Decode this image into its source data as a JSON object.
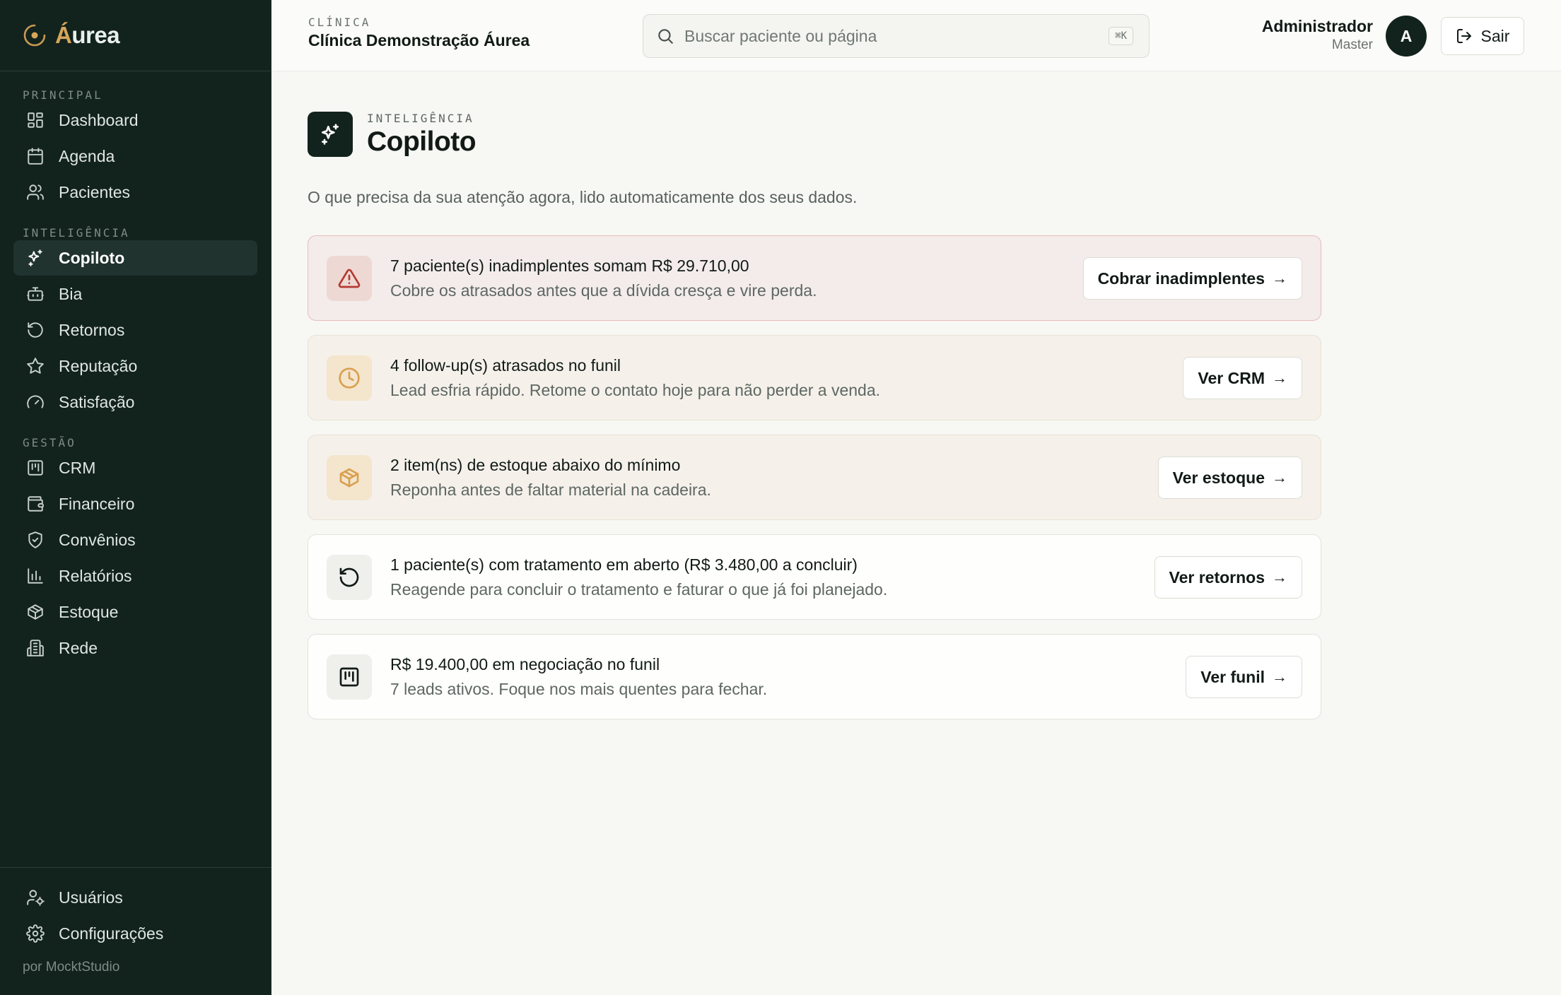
{
  "brand": {
    "name_first": "Á",
    "name_rest": "urea",
    "accent": "#d6a65a",
    "sidebar_bg": "#12221d"
  },
  "sidebar": {
    "sections": [
      {
        "label": "PRINCIPAL",
        "items": [
          {
            "label": "Dashboard",
            "icon": "dashboard-icon"
          },
          {
            "label": "Agenda",
            "icon": "calendar-icon"
          },
          {
            "label": "Pacientes",
            "icon": "users-icon"
          }
        ]
      },
      {
        "label": "INTELIGÊNCIA",
        "items": [
          {
            "label": "Copiloto",
            "icon": "sparkles-icon",
            "active": true
          },
          {
            "label": "Bia",
            "icon": "bot-icon"
          },
          {
            "label": "Retornos",
            "icon": "rotate-icon"
          },
          {
            "label": "Reputação",
            "icon": "star-icon"
          },
          {
            "label": "Satisfação",
            "icon": "gauge-icon"
          }
        ]
      },
      {
        "label": "GESTÃO",
        "items": [
          {
            "label": "CRM",
            "icon": "kanban-icon"
          },
          {
            "label": "Financeiro",
            "icon": "wallet-icon"
          },
          {
            "label": "Convênios",
            "icon": "shield-icon"
          },
          {
            "label": "Relatórios",
            "icon": "bar-chart-icon"
          },
          {
            "label": "Estoque",
            "icon": "package-icon"
          },
          {
            "label": "Rede",
            "icon": "building-icon"
          }
        ]
      }
    ],
    "bottom": [
      {
        "label": "Usuários",
        "icon": "user-cog-icon"
      },
      {
        "label": "Configurações",
        "icon": "settings-icon"
      }
    ],
    "powered_by": "por MocktStudio"
  },
  "topbar": {
    "clinic_label": "CLÍNICA",
    "clinic_name": "Clínica Demonstração Áurea",
    "search_placeholder": "Buscar paciente ou página",
    "search_shortcut": "⌘K",
    "user_name": "Administrador",
    "user_role": "Master",
    "avatar_initial": "A",
    "logout_label": "Sair"
  },
  "page": {
    "overline": "INTELIGÊNCIA",
    "title": "Copiloto",
    "description": "O que precisa da sua atenção agora, lido automaticamente dos seus dados."
  },
  "cards": [
    {
      "tone": "danger",
      "icon": "alert-triangle-icon",
      "title": "7 paciente(s) inadimplentes somam R$ 29.710,00",
      "subtitle": "Cobre os atrasados antes que a dívida cresça e vire perda.",
      "action": "Cobrar inadimplentes"
    },
    {
      "tone": "warn",
      "icon": "clock-icon",
      "title": "4 follow-up(s) atrasados no funil",
      "subtitle": "Lead esfria rápido. Retome o contato hoje para não perder a venda.",
      "action": "Ver CRM"
    },
    {
      "tone": "warn",
      "icon": "package-icon",
      "title": "2 item(ns) de estoque abaixo do mínimo",
      "subtitle": "Reponha antes de faltar material na cadeira.",
      "action": "Ver estoque"
    },
    {
      "tone": "neutral",
      "icon": "rotate-icon",
      "title": "1 paciente(s) com tratamento em aberto (R$ 3.480,00 a concluir)",
      "subtitle": "Reagende para concluir o tratamento e faturar o que já foi planejado.",
      "action": "Ver retornos"
    },
    {
      "tone": "neutral",
      "icon": "kanban-icon",
      "title": "R$ 19.400,00 em negociação no funil",
      "subtitle": "7 leads ativos. Foque nos mais quentes para fechar.",
      "action": "Ver funil"
    }
  ],
  "arrow": "→"
}
